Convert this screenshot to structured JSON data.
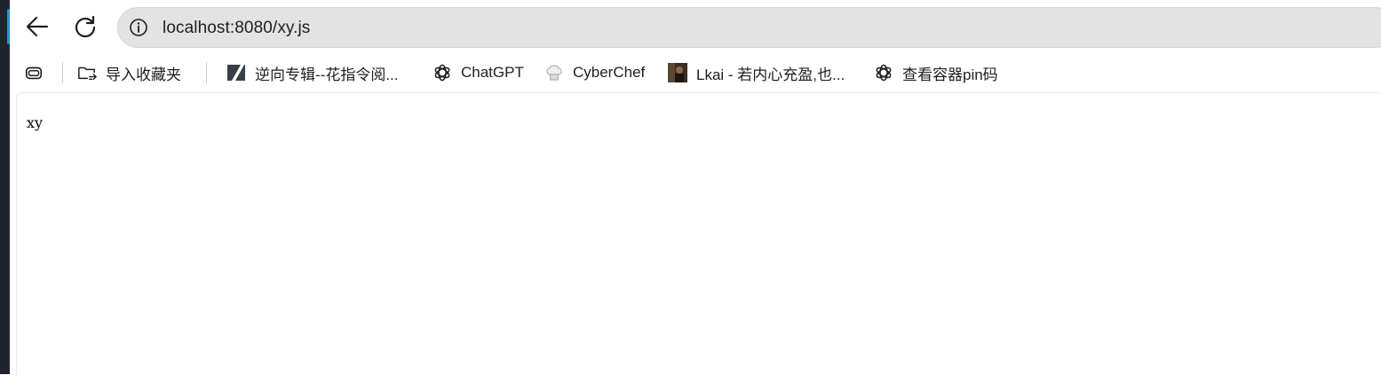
{
  "browser": {
    "url": "localhost:8080/xy.js",
    "back_icon": "arrow-left",
    "reload_icon": "reload",
    "info_icon": "info-circle"
  },
  "bookmarks": {
    "items": [
      {
        "label": "",
        "icon": "tab-groups-icon"
      },
      {
        "label": "导入收藏夹",
        "icon": "import-folder-icon"
      },
      {
        "label": "逆向专辑--花指令阅...",
        "icon": "slash-logo-icon"
      },
      {
        "label": "ChatGPT",
        "icon": "openai-icon"
      },
      {
        "label": "CyberChef",
        "icon": "chef-hat-icon"
      },
      {
        "label": "Lkai - 若内心充盈,也...",
        "icon": "avatar-thumbnail"
      },
      {
        "label": "查看容器pin码",
        "icon": "openai-icon"
      }
    ]
  },
  "page": {
    "body_text": "xy"
  },
  "colors": {
    "address_bar_bg": "#e3e3e3",
    "text": "#1f1f1f",
    "window_edge": "#20252d",
    "accent": "#2b8fc6"
  }
}
